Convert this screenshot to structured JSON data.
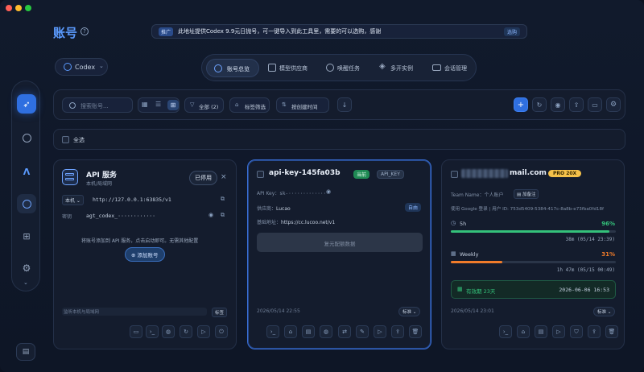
{
  "header": {
    "title": "账号",
    "notice_badge": "推广",
    "notice_text": "此地址提供Codex 9.9元日抛号，可一键导入到此工具里，需要的可以选购，感谢",
    "notice_action": "选购",
    "model_select": "Codex"
  },
  "tabs": [
    {
      "label": "账号总览"
    },
    {
      "label": "模型供应商"
    },
    {
      "label": "唤醒任务"
    },
    {
      "label": "多开实例"
    },
    {
      "label": "会话管理"
    }
  ],
  "toolbar": {
    "search_placeholder": "搜索账号...",
    "filter_all": "全部 (2)",
    "tag_filter": "标签筛选",
    "sort": "按创建时间"
  },
  "select_all": "全选",
  "card_api": {
    "title": "API 服务",
    "subtitle": "本机/局域网",
    "status": "已停用",
    "scope": "本机",
    "url": "http://127.0.0.1:63835/v1",
    "key_label": "密钥",
    "key_value": "agt_codex_············",
    "empty_text": "将账号添加到 API 服务，点击启动即可。无需其他配置",
    "add_button": "添加账号",
    "footer_placeholder": "监听本机与局域网",
    "footer_tag": "标签"
  },
  "card_key": {
    "title": "api-key-145fa03b",
    "badge_current": "当前",
    "badge_type": "API_KEY",
    "api_key_label": "API Key：",
    "api_key_value": "sk-··············",
    "provider_label": "供应商：",
    "provider_value": "Lucao",
    "provider_badge": "自由",
    "base_label": "基础地址：",
    "base_value": "https://cc.lucoo.net/v1",
    "action": "复元配额数据",
    "date": "2026/05/14 22:55",
    "tier": "标准"
  },
  "card_account": {
    "email_suffix": "mail.com",
    "plan": "PRO 20X",
    "team_label": "Team Name：个人账户",
    "note_button": "加备注",
    "login_info": "使用 Google 登录 | 用户 ID: 753d5409-5384-417c-8a8b-e73fba0fd18f",
    "quota_5h_label": "5h",
    "quota_5h_value": "96%",
    "quota_5h_fraction": 0.96,
    "quota_5h_reset": "38m (05/14 23:39)",
    "quota_weekly_label": "Weekly",
    "quota_weekly_value": "31%",
    "quota_weekly_fraction": 0.31,
    "quota_weekly_reset": "1h 47m (05/15 00:49)",
    "expiry_label": "有效期 23天",
    "expiry_date": "2026-06-06 16:53",
    "date": "2026/05/14 23:01",
    "tier": "标准"
  },
  "colors": {
    "accent": "#2f6fe0",
    "green": "#34c17a",
    "orange": "#f07b2a",
    "plan_gold": "#f5c14a"
  }
}
